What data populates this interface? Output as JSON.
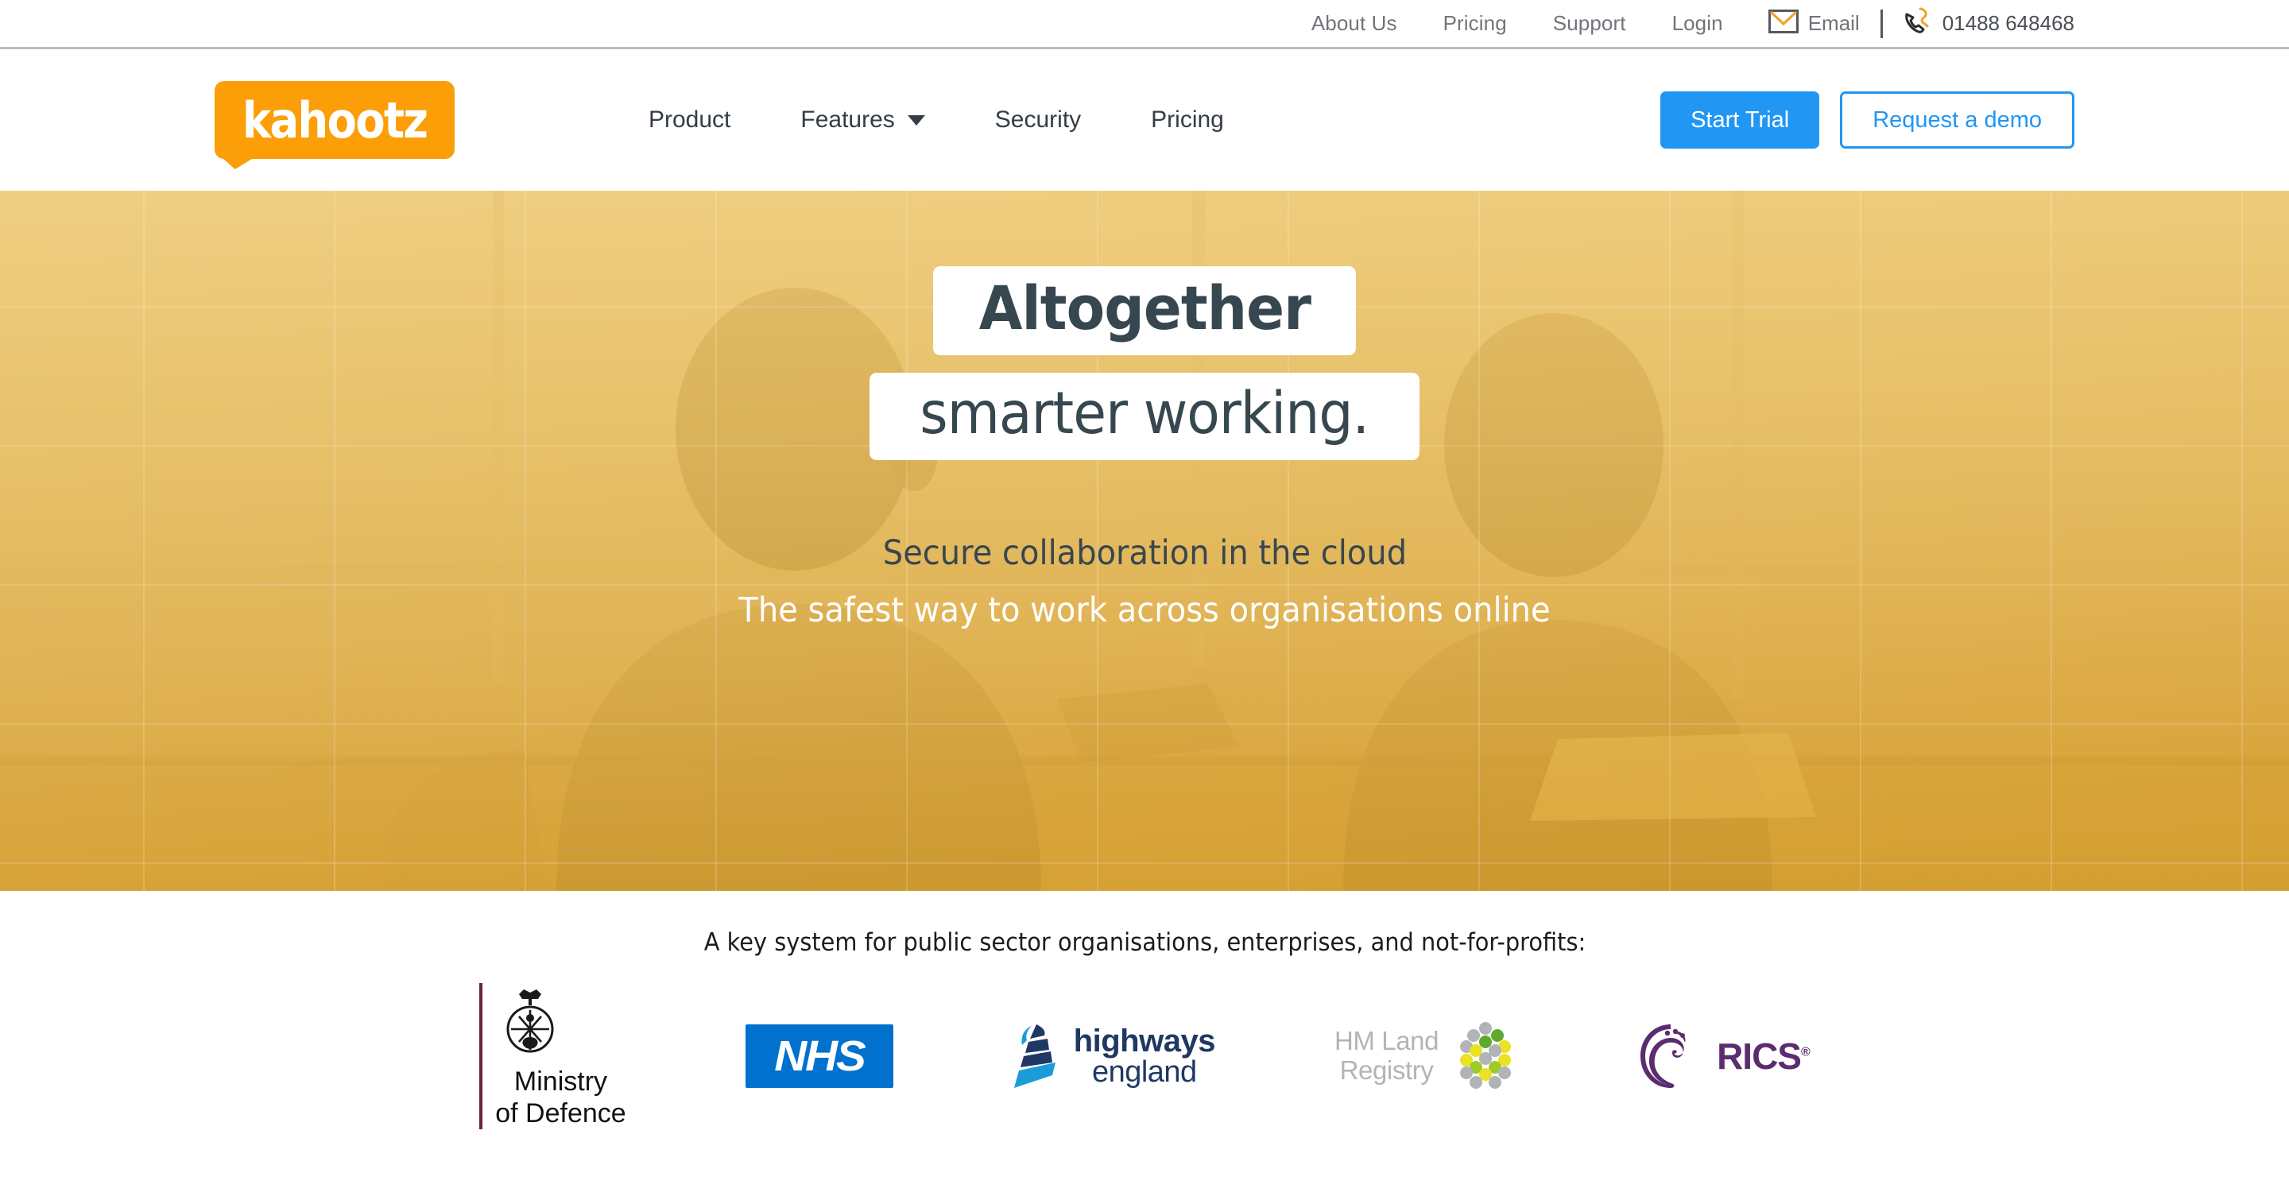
{
  "topbar": {
    "links": [
      {
        "label": "About Us",
        "name": "about-us"
      },
      {
        "label": "Pricing",
        "name": "pricing"
      },
      {
        "label": "Support",
        "name": "support"
      },
      {
        "label": "Login",
        "name": "login"
      }
    ],
    "email_label": "Email",
    "email_icon": "envelope-icon",
    "phone_number": "01488 648468",
    "phone_icon": "phone-icon"
  },
  "header": {
    "logo_text": "kahootz",
    "logo_color": "#fb9e07",
    "nav": [
      {
        "label": "Product",
        "has_dropdown": false
      },
      {
        "label": "Features",
        "has_dropdown": true
      },
      {
        "label": "Security",
        "has_dropdown": false
      },
      {
        "label": "Pricing",
        "has_dropdown": false
      }
    ],
    "cta_primary": "Start Trial",
    "cta_outline": "Request a demo",
    "accent_blue": "#2196f3"
  },
  "hero": {
    "headline_line1": "Altogether",
    "headline_line2": "smarter working.",
    "subline_1": "Secure collaboration in the cloud",
    "subline_2": "The safest way to work across organisations online",
    "overlay_color": "#eec463",
    "text_color": "#37474f"
  },
  "clients": {
    "title": "A key system for public sector organisations, enterprises, and not-for-profits:",
    "logos": [
      {
        "name": "ministry-of-defence",
        "line1": "Ministry",
        "line2": "of Defence",
        "color": "#6b2140"
      },
      {
        "name": "nhs",
        "text": "NHS",
        "color": "#0072ce"
      },
      {
        "name": "highways-england",
        "line1": "highways",
        "line2": "england",
        "color": "#1f3864"
      },
      {
        "name": "hm-land-registry",
        "line1": "HM Land",
        "line2": "Registry",
        "color": "#b4b4b4"
      },
      {
        "name": "rics",
        "text": "RICS",
        "color": "#5b2d6e"
      }
    ]
  }
}
